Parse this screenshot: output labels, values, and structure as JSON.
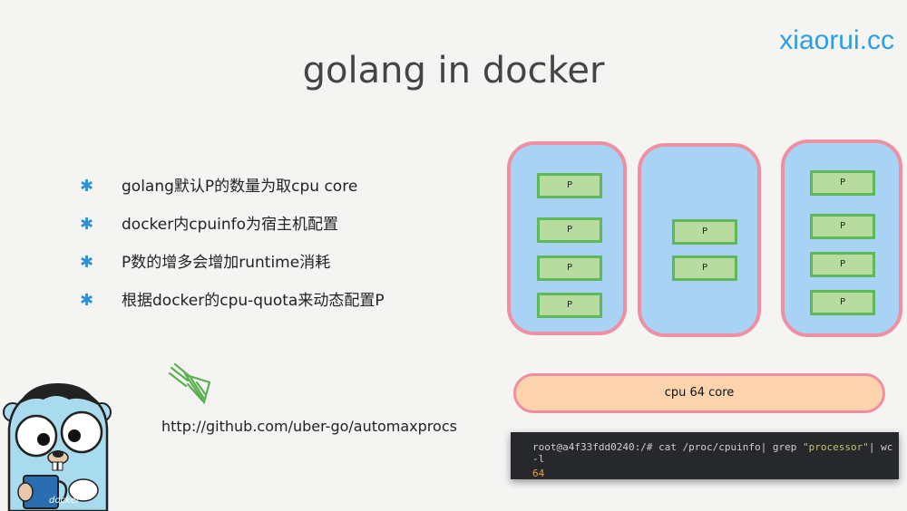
{
  "header": {
    "site": "xiaorui.cc",
    "title": "golang in docker"
  },
  "bullets": [
    {
      "marker": "✱",
      "text": "golang默认P的数量为取cpu core"
    },
    {
      "marker": "✱",
      "text": "docker内cpuinfo为宿主机配置"
    },
    {
      "marker": "✱",
      "text": "P数的增多会增加runtime消耗"
    },
    {
      "marker": "✱",
      "text": "根据docker的cpu-quota来动态配置P"
    }
  ],
  "diagram": {
    "p_label": "P",
    "cpu_label": "cpu 64 core",
    "containers": [
      {
        "p_count": 4
      },
      {
        "p_count": 2
      },
      {
        "p_count": 4
      }
    ]
  },
  "terminal": {
    "prompt": "root@a4f33fdd0240:/# cat /proc/cpuinfo| grep ",
    "quoted": "\"processor\"",
    "rest": "| wc -l",
    "output": "64"
  },
  "link": "http://github.com/uber-go/automaxprocs",
  "gopher_label": "docker",
  "colors": {
    "site": "#2c9ee6",
    "container_fill": "#a9d3f5",
    "container_border": "#ef8fa2",
    "p_fill": "#b8dc9f",
    "p_border": "#5fb95a",
    "cpu_fill": "#fbd3ac"
  }
}
